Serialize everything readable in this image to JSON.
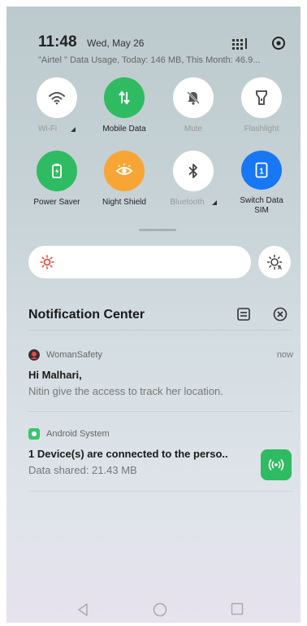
{
  "status": {
    "time": "11:48",
    "date": "Wed, May 26",
    "usage": "\"Airtel \" Data Usage, Today: 146 MB, This Month: 46.9..."
  },
  "tiles": [
    {
      "label": "Wi-Fi",
      "icon": "wifi-icon",
      "active": false,
      "has_arrow": true
    },
    {
      "label": "Mobile Data",
      "icon": "mobile-data-icon",
      "active": true,
      "has_arrow": false
    },
    {
      "label": "Mute",
      "icon": "mute-icon",
      "active": false,
      "has_arrow": false
    },
    {
      "label": "Flashlight",
      "icon": "flashlight-icon",
      "active": false,
      "has_arrow": false
    },
    {
      "label": "Power Saver",
      "icon": "power-saver-icon",
      "active": true,
      "has_arrow": false
    },
    {
      "label": "Night Shield",
      "icon": "night-shield-icon",
      "active": true,
      "has_arrow": false
    },
    {
      "label": "Bluetooth",
      "icon": "bluetooth-icon",
      "active": false,
      "has_arrow": true
    },
    {
      "label": "Switch Data SIM",
      "icon": "sim-icon",
      "active": true,
      "has_arrow": false
    }
  ],
  "brightness": {
    "level": 0
  },
  "notification_center": {
    "title": "Notification Center",
    "notifications": [
      {
        "app": "WomanSafety",
        "time": "now",
        "title": "Hi Malhari,",
        "body": "Nitin give the access to track her location."
      },
      {
        "app": "Android System",
        "title": "1 Device(s) are connected to the perso..",
        "body": "Data shared: 21.43 MB"
      }
    ]
  },
  "colors": {
    "green": "#2fbb62",
    "orange": "#f7a635",
    "blue": "#1877f2",
    "brightness_sun": "#e74c3c"
  }
}
